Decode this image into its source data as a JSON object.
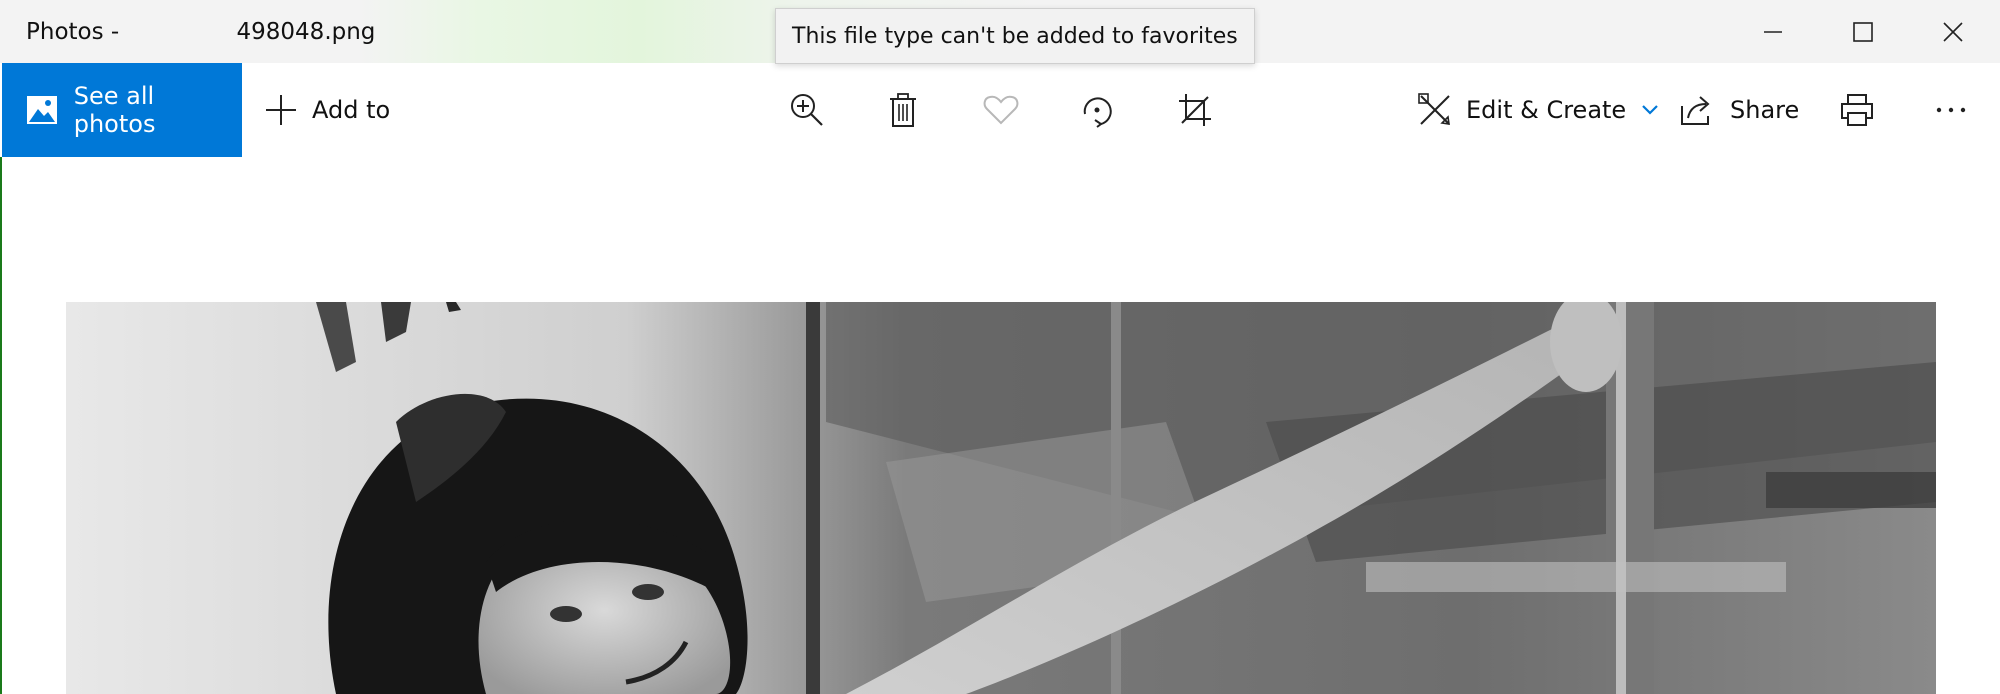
{
  "window": {
    "app_name": "Photos - ",
    "file_name": "498048.png"
  },
  "toolbar": {
    "see_all_label": "See all photos",
    "add_to_label": "Add to",
    "edit_create_label": "Edit & Create",
    "share_label": "Share",
    "icons": [
      "zoom-in-icon",
      "delete-icon",
      "favorite-icon",
      "rotate-icon",
      "crop-icon",
      "print-icon",
      "more-icon"
    ]
  },
  "tooltip": {
    "text": "This file type can't be added to favorites"
  },
  "colors": {
    "accent": "#0078d7",
    "titlebar_bg": "#f3f3f3",
    "disabled_icon": "#b8b8b8"
  }
}
